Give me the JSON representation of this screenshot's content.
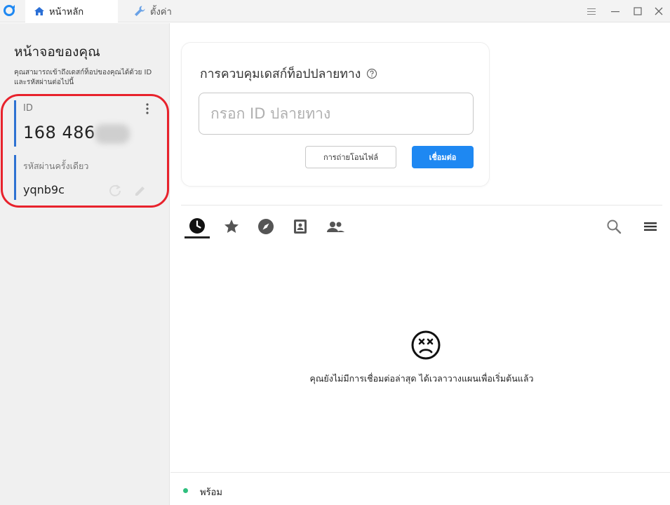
{
  "titlebar": {
    "tabs": [
      {
        "label": "หน้าหลัก",
        "icon": "home-icon"
      },
      {
        "label": "ตั้งค่า",
        "icon": "wrench-icon"
      }
    ]
  },
  "sidebar": {
    "title": "หน้าจอของคุณ",
    "description": "คุณสามารถเข้าถึงเดสก์ท็อปของคุณได้ด้วย ID และรหัสผ่านต่อไปนี้",
    "id_label": "ID",
    "id_value": "168 486",
    "password_label": "รหัสผ่านครั้งเดียว",
    "password_value": "yqnb9c"
  },
  "remote": {
    "title": "การควบคุมเดสก์ท็อปปลายทาง",
    "input_placeholder": "กรอก ID ปลายทาง",
    "transfer_button": "การถ่ายโอนไฟล์",
    "connect_button": "เชื่อมต่อ"
  },
  "peer_tabs": [
    {
      "icon": "history-clock-icon",
      "active": true
    },
    {
      "icon": "star-icon"
    },
    {
      "icon": "compass-icon"
    },
    {
      "icon": "address-book-icon"
    },
    {
      "icon": "group-icon"
    }
  ],
  "empty_state": {
    "icon": "sad-face-icon",
    "message": "คุณยังไม่มีการเชื่อมต่อล่าสุด ได้เวลาวางแผนเพื่อเริ่มต้นแล้ว"
  },
  "status": {
    "text": "พร้อม",
    "color": "#2fbf7e"
  },
  "colors": {
    "accent": "#1e88f2",
    "highlight": "#e8222c"
  }
}
